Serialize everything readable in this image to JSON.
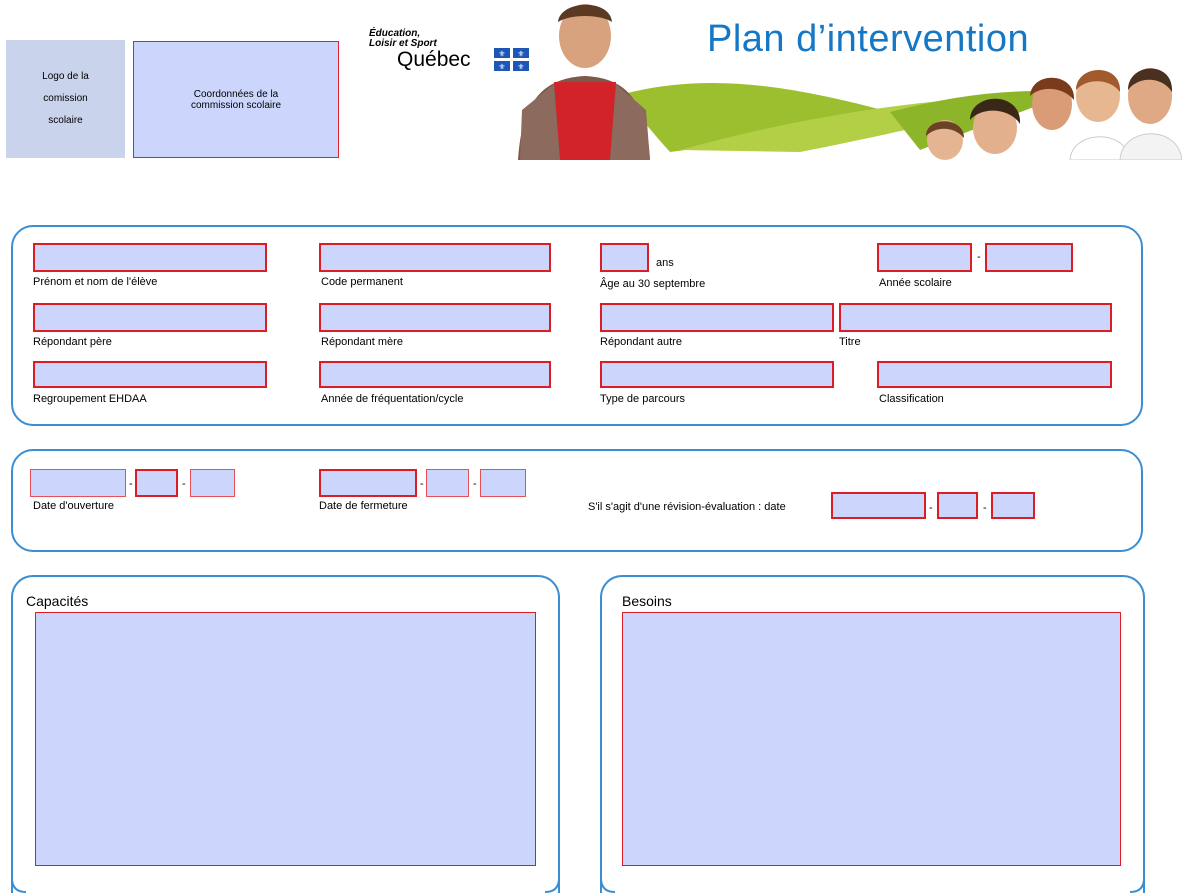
{
  "header": {
    "logo_box": [
      "Logo de la",
      "comission",
      "scolaire"
    ],
    "coord_box": [
      "Coordonnées de la",
      "commission scolaire"
    ],
    "ministry_line1": "Éducation,",
    "ministry_line2": "Loisir et Sport",
    "ministry_quebec": "Québec",
    "title": "Plan d’intervention"
  },
  "student": {
    "name_label": "Prénom et nom de l'élève",
    "code_label": "Code permanent",
    "age_unit": "ans",
    "age_label": "Âge au 30 septembre",
    "year_label": "Année scolaire",
    "father_label": "Répondant père",
    "mother_label": "Répondant mère",
    "other_label": "Répondant autre",
    "titre_label": "Titre",
    "group_label": "Regroupement EHDAA",
    "attendance_label": "Année de fréquentation/cycle",
    "path_label": "Type de parcours",
    "class_label": "Classification"
  },
  "dates": {
    "open_label": "Date d'ouverture",
    "close_label": "Date de fermeture",
    "revision_label": "S'il s'agit d'une révision-évaluation : date"
  },
  "panels": {
    "capacities": "Capacités",
    "needs": "Besoins"
  },
  "separator": "-",
  "colors": {
    "panel_border": "#3b8ed1",
    "field_fill": "#ccd6fd",
    "field_border": "#dd1d26",
    "title": "#1677c5"
  }
}
